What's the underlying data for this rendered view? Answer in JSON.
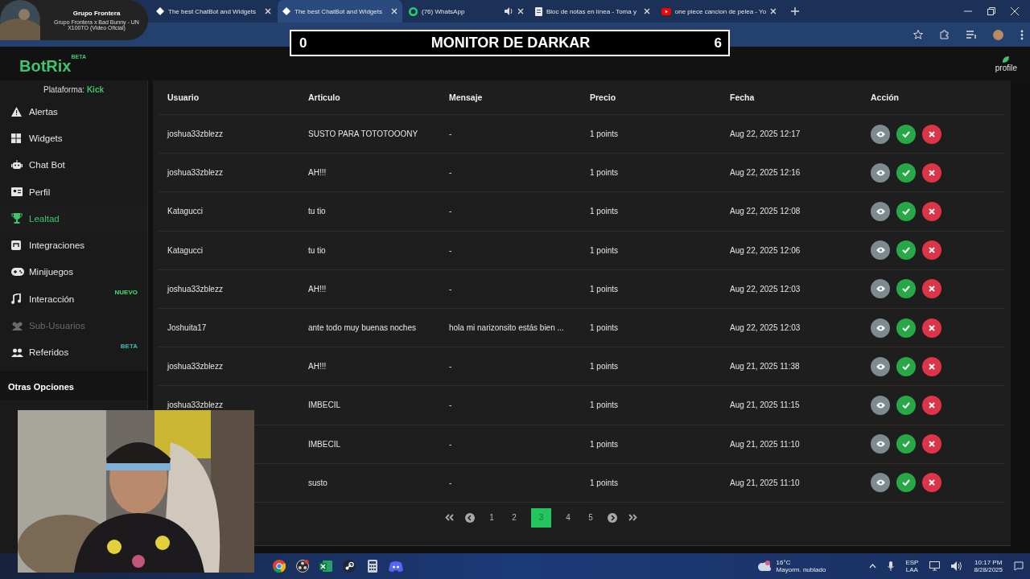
{
  "browser": {
    "tabs": [
      {
        "title": "The best ChatBot and Widgets",
        "kind": "botrix",
        "selected": false,
        "audio": false
      },
      {
        "title": "The best ChatBot and Widgets",
        "kind": "botrix",
        "selected": true,
        "audio": false
      },
      {
        "title": "(76) WhatsApp",
        "kind": "whatsapp",
        "selected": false,
        "audio": true
      },
      {
        "title": "Bloc de notas en línea - Toma y",
        "kind": "notepad",
        "selected": false,
        "audio": false
      },
      {
        "title": "one piece cancion de pelea - Yo",
        "kind": "youtube",
        "selected": false,
        "audio": false
      }
    ],
    "media_card": {
      "title": "Grupo Frontera",
      "subtitle": "Grupo Frontera x Bad Bunny - UN X100TO (Video Oficial)"
    }
  },
  "overlay": {
    "left_score": "0",
    "title": "MONITOR DE DARKAR",
    "right_score": "6"
  },
  "app": {
    "logo": "BotRix",
    "logo_badge": "BETA",
    "profile": "profile"
  },
  "sidebar": {
    "platform_label": "Plataforma:",
    "platform_value": "Kick",
    "items": [
      {
        "label": "Alertas",
        "kind": "warning",
        "selected": false,
        "disabled": false
      },
      {
        "label": "Widgets",
        "kind": "grid",
        "selected": false,
        "disabled": false
      },
      {
        "label": "Chat Bot",
        "kind": "robot",
        "selected": false,
        "disabled": false
      },
      {
        "label": "Perfil",
        "kind": "card",
        "selected": false,
        "disabled": false
      },
      {
        "label": "Lealtad",
        "kind": "trophy",
        "selected": true,
        "disabled": false
      },
      {
        "label": "Integraciones",
        "kind": "plug",
        "selected": false,
        "disabled": false
      },
      {
        "label": "Minijuegos",
        "kind": "gamepad",
        "selected": false,
        "disabled": false
      },
      {
        "label": "Interacción",
        "kind": "music",
        "selected": false,
        "disabled": false,
        "badge": {
          "text": "NUEVO",
          "kind": "new"
        }
      },
      {
        "label": "Sub-Usuarios",
        "kind": "users",
        "selected": false,
        "disabled": true
      },
      {
        "label": "Referidos",
        "kind": "people",
        "selected": false,
        "disabled": false,
        "badge": {
          "text": "BETA",
          "kind": "beta"
        }
      }
    ],
    "section": "Otras Opciones"
  },
  "table": {
    "columns": [
      "Usuario",
      "Articulo",
      "Mensaje",
      "Precio",
      "Fecha",
      "Acción"
    ],
    "rows": [
      {
        "usuario": "joshua33zblezz",
        "articulo": "SUSTO PARA TOTOTOOONY",
        "mensaje": "-",
        "precio": "1 points",
        "fecha": "Aug 22, 2025 12:17"
      },
      {
        "usuario": "joshua33zblezz",
        "articulo": "AH!!!",
        "mensaje": "-",
        "precio": "1 points",
        "fecha": "Aug 22, 2025 12:16"
      },
      {
        "usuario": "Katagucci",
        "articulo": "tu tio",
        "mensaje": "-",
        "precio": "1 points",
        "fecha": "Aug 22, 2025 12:08"
      },
      {
        "usuario": "Katagucci",
        "articulo": "tu tio",
        "mensaje": "-",
        "precio": "1 points",
        "fecha": "Aug 22, 2025 12:06"
      },
      {
        "usuario": "joshua33zblezz",
        "articulo": "AH!!!",
        "mensaje": "-",
        "precio": "1 points",
        "fecha": "Aug 22, 2025 12:03"
      },
      {
        "usuario": "Joshuita17",
        "articulo": "ante todo muy buenas noches",
        "mensaje": "hola mi narizonsito estás bien ...",
        "precio": "1 points",
        "fecha": "Aug 22, 2025 12:03"
      },
      {
        "usuario": "joshua33zblezz",
        "articulo": "AH!!!",
        "mensaje": "-",
        "precio": "1 points",
        "fecha": "Aug 21, 2025 11:38"
      },
      {
        "usuario": "joshua33zblezz",
        "articulo": "IMBECIL",
        "mensaje": "-",
        "precio": "1 points",
        "fecha": "Aug 21, 2025 11:15"
      },
      {
        "articulo": "IMBECIL",
        "mensaje": "-",
        "precio": "1 points",
        "fecha": "Aug 21, 2025 11:10"
      },
      {
        "articulo": "susto",
        "mensaje": "-",
        "precio": "1 points",
        "fecha": "Aug 21, 2025 11:10"
      }
    ]
  },
  "pagination": [
    {
      "kind": "first"
    },
    {
      "kind": "prev"
    },
    {
      "kind": "page",
      "label": "1",
      "selected": false
    },
    {
      "kind": "page",
      "label": "2",
      "selected": false
    },
    {
      "kind": "page",
      "label": "3",
      "selected": true
    },
    {
      "kind": "page",
      "label": "4",
      "selected": false
    },
    {
      "kind": "page",
      "label": "5",
      "selected": false
    },
    {
      "kind": "next"
    },
    {
      "kind": "last"
    }
  ],
  "taskbar": {
    "apps": [
      {
        "kind": "chrome"
      },
      {
        "kind": "obs"
      },
      {
        "kind": "excel"
      },
      {
        "kind": "steam"
      },
      {
        "kind": "calculator"
      },
      {
        "kind": "discord"
      }
    ],
    "weather": {
      "temp": "16°C",
      "desc": "Mayorm. nublado"
    },
    "lang": "ESP",
    "region": "LAA",
    "time": "10:17 PM",
    "date": "8/28/2025"
  }
}
